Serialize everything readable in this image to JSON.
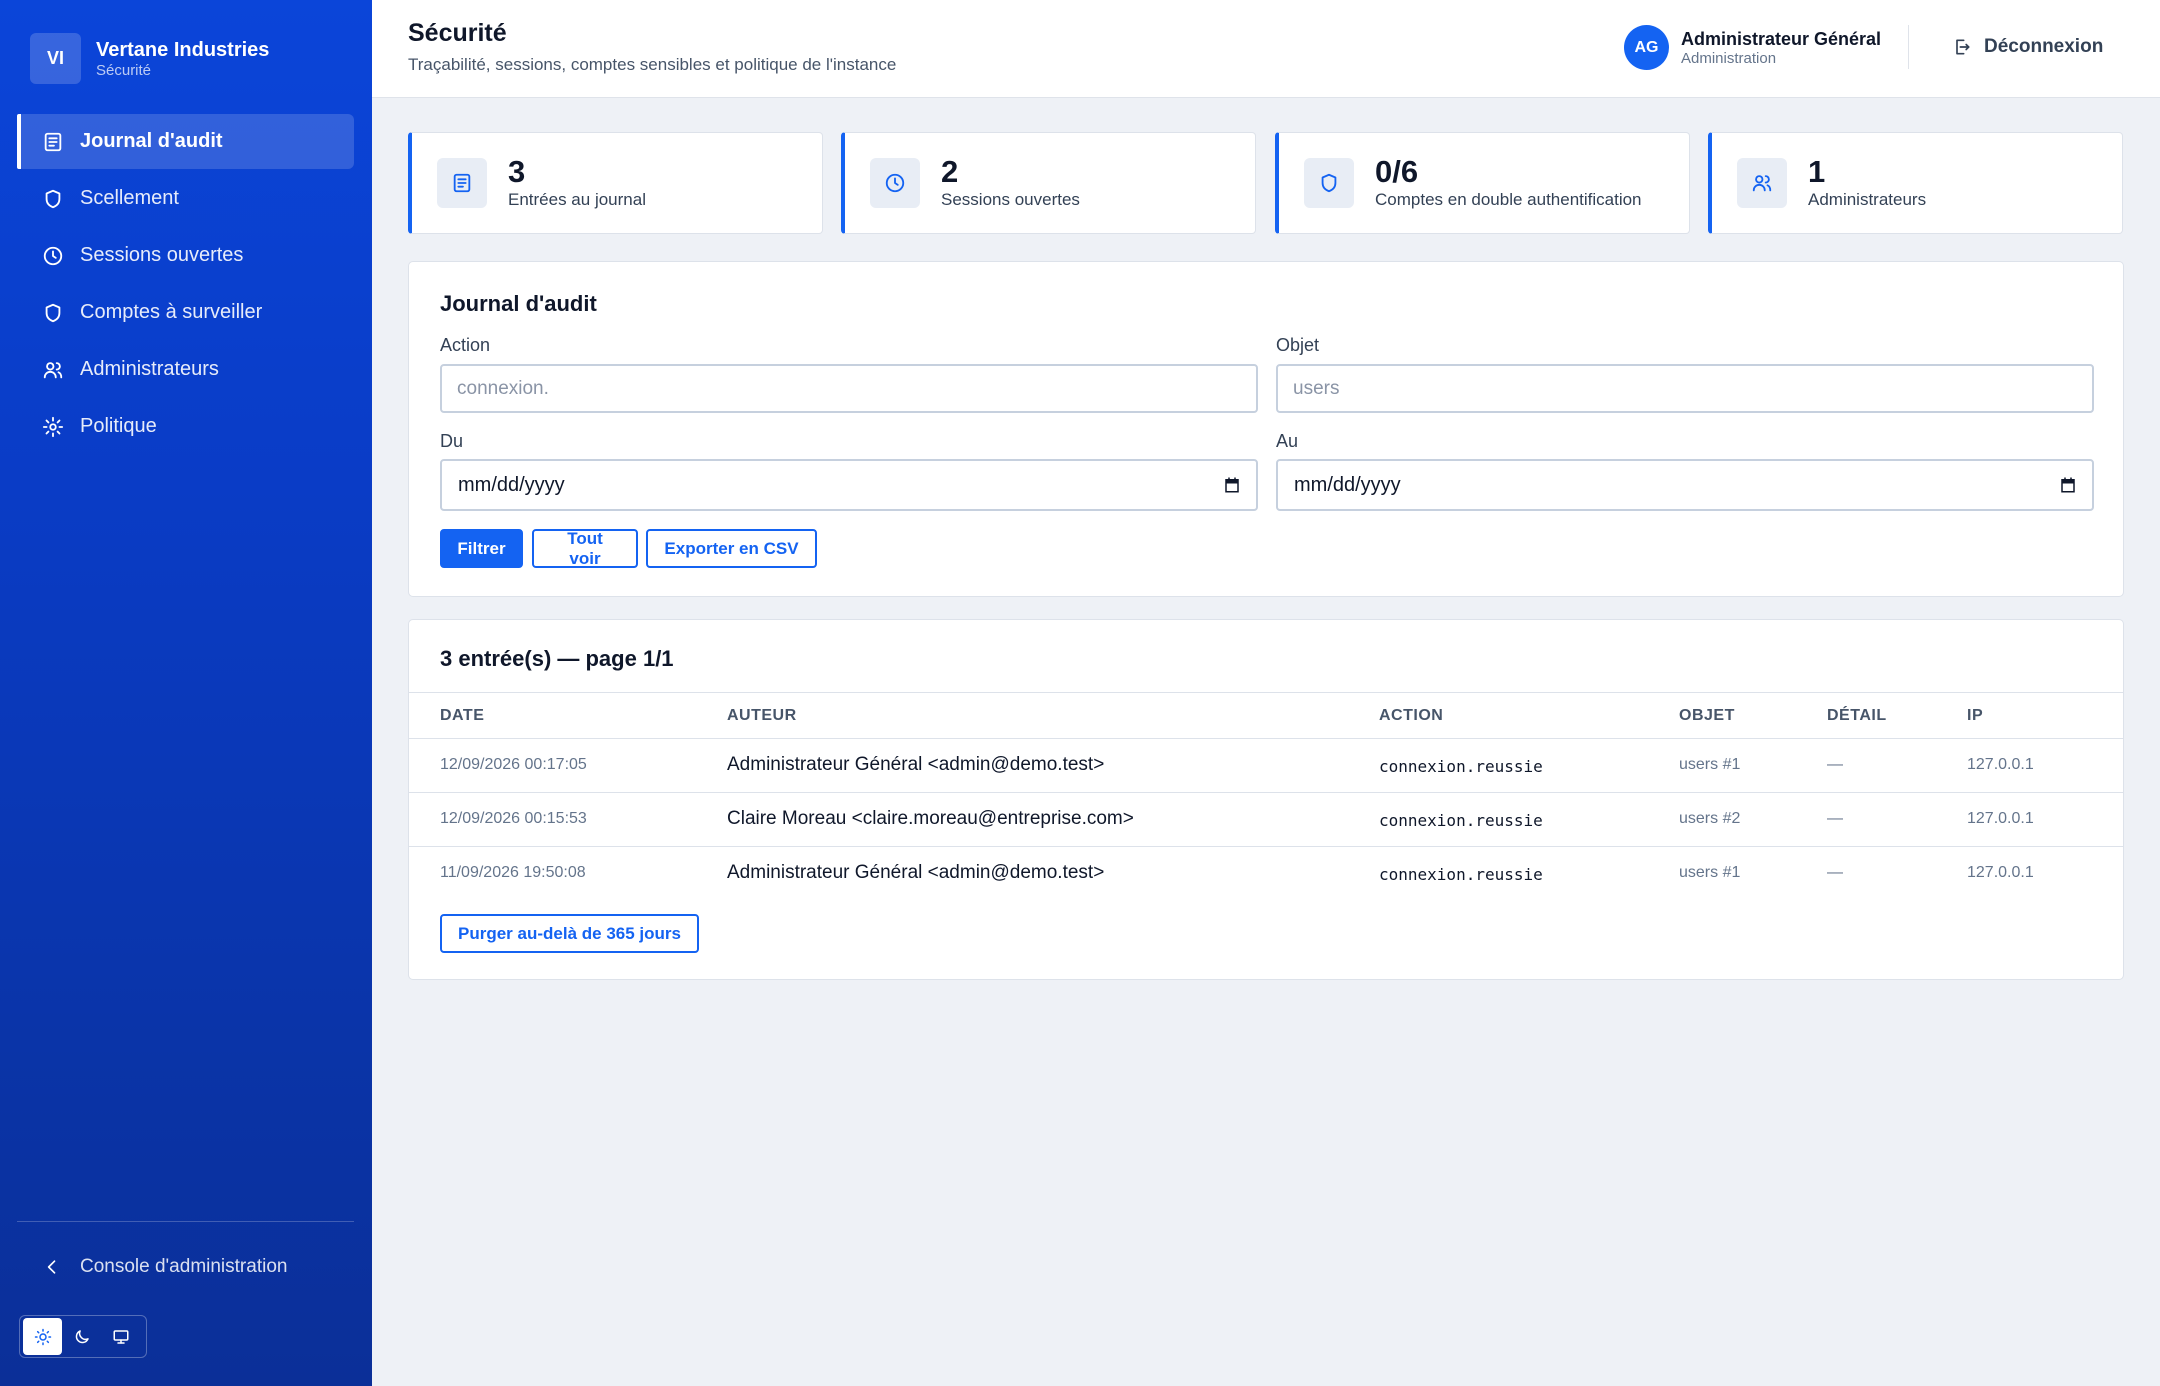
{
  "brand": {
    "initials": "VI",
    "name": "Vertane Industries",
    "section": "Sécurité"
  },
  "sidebar": {
    "items": [
      {
        "label": "Journal d'audit",
        "icon": "document-icon"
      },
      {
        "label": "Scellement",
        "icon": "shield-icon"
      },
      {
        "label": "Sessions ouvertes",
        "icon": "clock-icon"
      },
      {
        "label": "Comptes à surveiller",
        "icon": "shield-icon"
      },
      {
        "label": "Administrateurs",
        "icon": "users-icon"
      },
      {
        "label": "Politique",
        "icon": "gear-icon"
      }
    ],
    "active_index": 0,
    "console_label": "Console d'administration",
    "theme_options": [
      "sun-icon",
      "moon-icon",
      "monitor-icon"
    ]
  },
  "header": {
    "title": "Sécurité",
    "subtitle": "Traçabilité, sessions, comptes sensibles et politique de l'instance",
    "user": {
      "initials": "AG",
      "name": "Administrateur Général",
      "role": "Administration"
    },
    "logout_label": "Déconnexion"
  },
  "stats": [
    {
      "value": "3",
      "label": "Entrées au journal",
      "icon": "document-icon"
    },
    {
      "value": "2",
      "label": "Sessions ouvertes",
      "icon": "clock-icon"
    },
    {
      "value": "0/6",
      "label": "Comptes en double authentification",
      "icon": "shield-icon"
    },
    {
      "value": "1",
      "label": "Administrateurs",
      "icon": "users-icon"
    }
  ],
  "filters": {
    "title": "Journal d'audit",
    "action_label": "Action",
    "action_placeholder": "connexion.",
    "object_label": "Objet",
    "object_placeholder": "users",
    "from_label": "Du",
    "from_value": "mm/dd/yyyy",
    "to_label": "Au",
    "to_value": "mm/dd/yyyy",
    "filter_button": "Filtrer",
    "view_all_button": "Tout voir",
    "export_button": "Exporter en CSV"
  },
  "table": {
    "title": "3 entrée(s) — page 1/1",
    "columns": [
      "DATE",
      "AUTEUR",
      "ACTION",
      "OBJET",
      "DÉTAIL",
      "IP"
    ],
    "rows": [
      [
        "12/09/2026 00:17:05",
        "Administrateur Général <admin@demo.test>",
        "connexion.reussie",
        "users #1",
        "—",
        "127.0.0.1"
      ],
      [
        "12/09/2026 00:15:53",
        "Claire Moreau <claire.moreau@entreprise.com>",
        "connexion.reussie",
        "users #2",
        "—",
        "127.0.0.1"
      ],
      [
        "11/09/2026 19:50:08",
        "Administrateur Général <admin@demo.test>",
        "connexion.reussie",
        "users #1",
        "—",
        "127.0.0.1"
      ]
    ],
    "purge_button": "Purger au-delà de 365 jours"
  },
  "colors": {
    "accent": "#1463f2",
    "sidebar": "#0b45d9",
    "background": "#eef1f6"
  }
}
